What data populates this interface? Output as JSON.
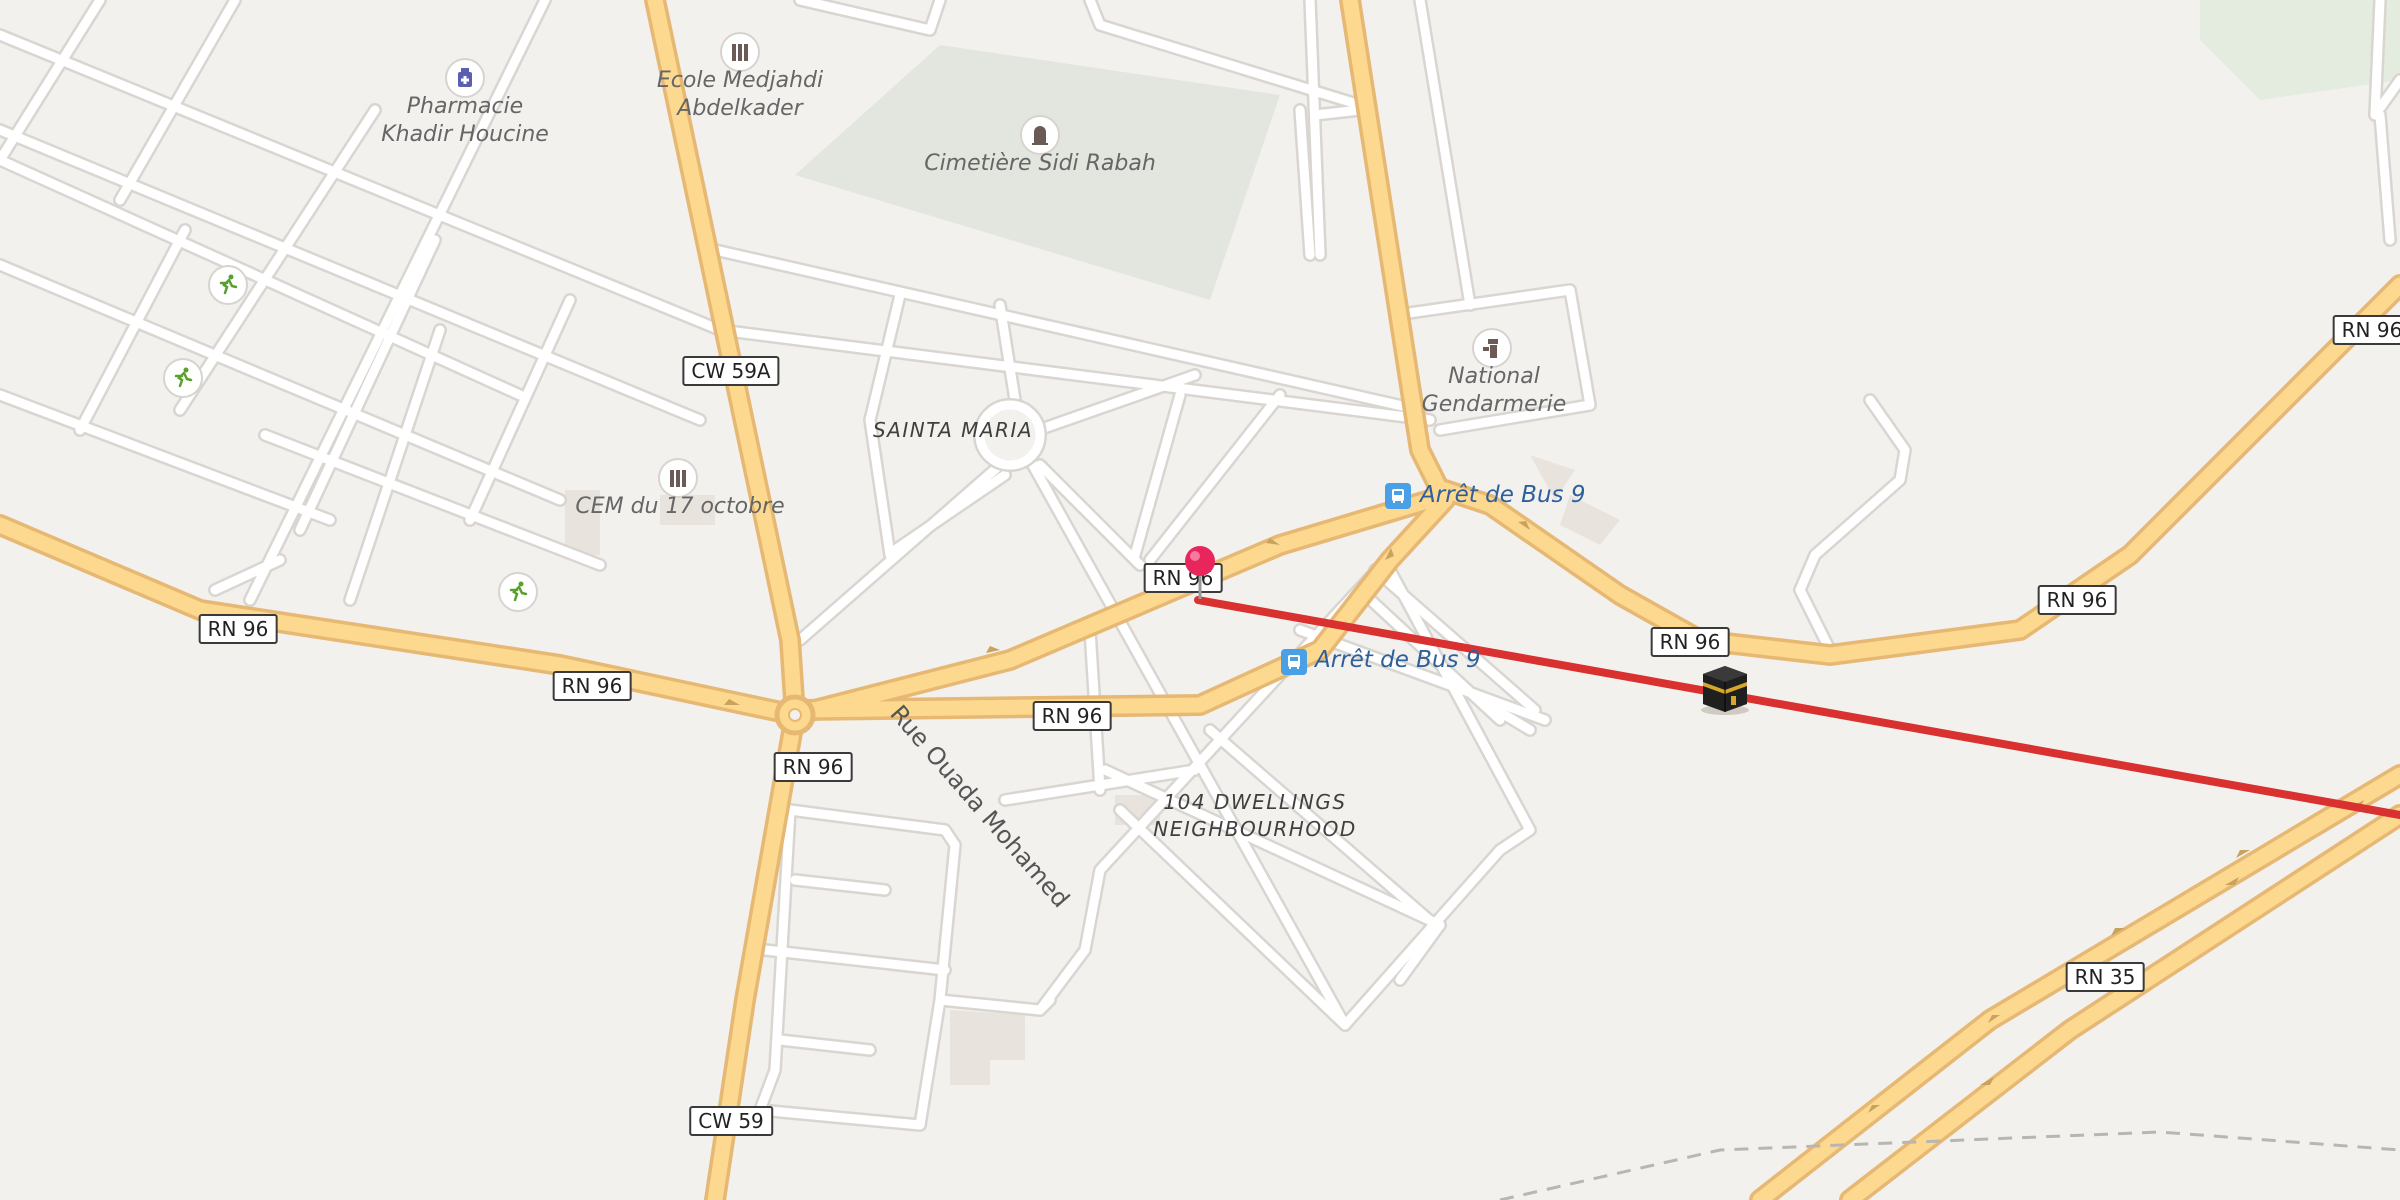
{
  "roads": {
    "rn96_labels": [
      "RN 96",
      "RN 96",
      "RN 96",
      "RN 96",
      "RN 96",
      "RN 96",
      "RN 96",
      "RN 96"
    ],
    "rn35": "RN 35",
    "cw59": "CW 59",
    "cw59a": "CW 59A"
  },
  "pois": {
    "pharmacie": "Pharmacie\nKhadir Houcine",
    "ecole": "Ecole Medjahdi\nAbdelkader",
    "cimetiere": "Cimetière Sidi Rabah",
    "gendarmerie": "National\nGendarmerie",
    "cem": "CEM du 17 octobre",
    "bus_stop_1": "Arrêt de Bus 9",
    "bus_stop_2": "Arrêt de Bus 9"
  },
  "places": {
    "sainta_maria": "SAINTA MARIA",
    "dwellings": "104 DWELLINGS\nNEIGHBOURHOOD"
  },
  "streets": {
    "ouada": "Rue Ouada Mohamed"
  },
  "icons": {
    "pin": "map-pin-icon",
    "kaaba": "kaaba-icon",
    "pharmacy": "pharmacy-icon",
    "school": "school-icon",
    "cemetery": "cemetery-icon",
    "police": "police-icon",
    "bus": "bus-stop-icon",
    "sport": "sport-icon"
  },
  "colors": {
    "background": "#f3f1ee",
    "major_road": "#fcd98f",
    "major_road_casing": "#e6b873",
    "minor_road": "#ffffff",
    "minor_road_casing": "#d9d6d1",
    "park": "#e2e6de",
    "qibla_line": "#d93030",
    "pin": "#e8265c"
  }
}
